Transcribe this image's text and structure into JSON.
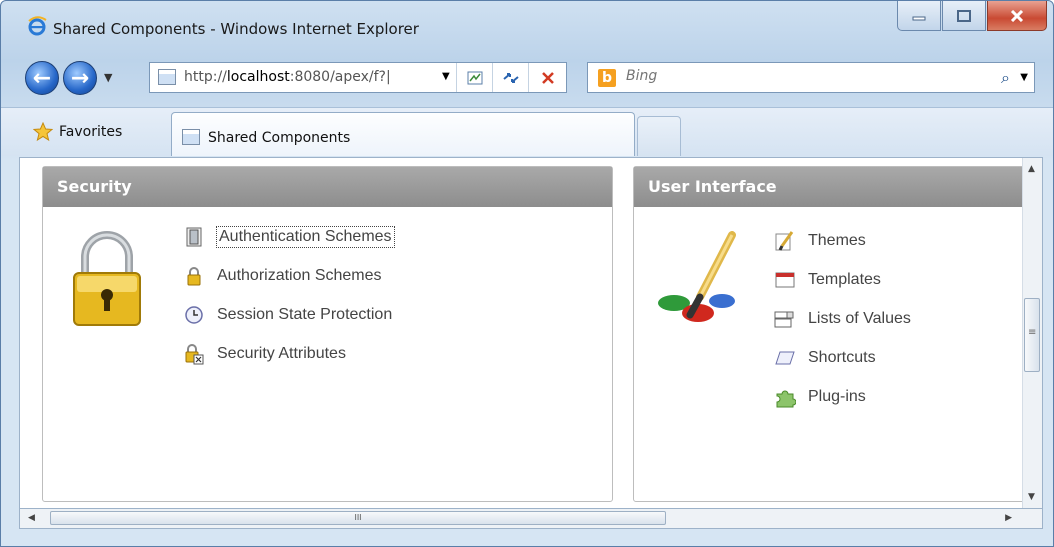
{
  "window": {
    "title": "Shared Components - Windows Internet Explorer",
    "minimize_icon": "minimize-icon",
    "maximize_icon": "maximize-icon",
    "close_icon": "close-icon"
  },
  "nav": {
    "url_prefix": "http://",
    "url_host": "localhost",
    "url_rest": ":8080/apex/f?|",
    "search_placeholder": "Bing"
  },
  "tabs": {
    "favorites_label": "Favorites",
    "active_tab_label": "Shared Components"
  },
  "security": {
    "heading": "Security",
    "links": [
      {
        "label": "Authentication Schemes",
        "icon": "door-icon"
      },
      {
        "label": "Authorization Schemes",
        "icon": "lock-icon"
      },
      {
        "label": "Session State Protection",
        "icon": "clock-icon"
      },
      {
        "label": "Security Attributes",
        "icon": "lock-attributes-icon"
      }
    ]
  },
  "user_interface": {
    "heading": "User Interface",
    "links": [
      {
        "label": "Themes",
        "icon": "brush-icon"
      },
      {
        "label": "Templates",
        "icon": "template-icon"
      },
      {
        "label": "Lists of Values",
        "icon": "list-icon"
      },
      {
        "label": "Shortcuts",
        "icon": "shortcut-icon"
      },
      {
        "label": "Plug-ins",
        "icon": "puzzle-icon"
      }
    ]
  },
  "scrollbar": {
    "grip": "≡",
    "hgrip": "III"
  },
  "colors": {
    "accent": "#2667c9",
    "panel_header": "#999999",
    "close_button": "#c94a33"
  }
}
